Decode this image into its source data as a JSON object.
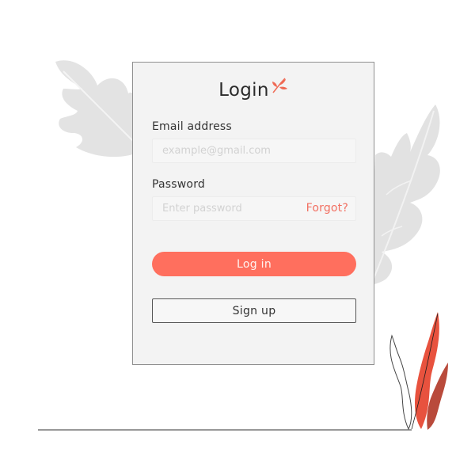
{
  "login": {
    "title": "Login",
    "email_label": "Email address",
    "email_placeholder": "example@gmail.com",
    "email_value": "",
    "password_label": "Password",
    "password_placeholder": "Enter password",
    "password_value": "",
    "forgot_label": "Forgot?",
    "login_button": "Log in",
    "signup_button": "Sign up"
  },
  "colors": {
    "accent": "#ff6f5e",
    "forgot": "#f27062",
    "leaf_gray": "#e2e2e2",
    "plant_red": "#e8523e",
    "plant_dark_red": "#b94a3b"
  },
  "icons": {
    "title_icon": "leaf-sprig-icon"
  }
}
